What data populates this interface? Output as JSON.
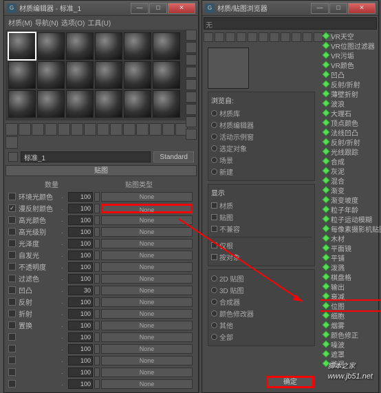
{
  "left": {
    "title": "材质编辑器 - 标准_1",
    "menu": [
      "材质(M)",
      "导航(N)",
      "选项(O)",
      "工具(U)"
    ],
    "material_name": "标准_1",
    "std_button": "Standard",
    "rollout": "贴图",
    "headers": {
      "amount": "数量",
      "type": "贴图类型"
    },
    "rows": [
      {
        "checked": false,
        "label": "环境光颜色",
        "val": "100",
        "btn": "None"
      },
      {
        "checked": true,
        "label": "漫反射颜色",
        "val": "100",
        "btn": "None",
        "highlight": true
      },
      {
        "checked": false,
        "label": "高光颜色",
        "val": "100",
        "btn": "None"
      },
      {
        "checked": false,
        "label": "高光级别",
        "val": "100",
        "btn": "None"
      },
      {
        "checked": false,
        "label": "光泽度",
        "val": "100",
        "btn": "None"
      },
      {
        "checked": false,
        "label": "自发光",
        "val": "100",
        "btn": "None"
      },
      {
        "checked": false,
        "label": "不透明度",
        "val": "100",
        "btn": "None"
      },
      {
        "checked": false,
        "label": "过滤色",
        "val": "100",
        "btn": "None"
      },
      {
        "checked": false,
        "label": "凹凸",
        "val": "30",
        "btn": "None"
      },
      {
        "checked": false,
        "label": "反射",
        "val": "100",
        "btn": "None"
      },
      {
        "checked": false,
        "label": "折射",
        "val": "100",
        "btn": "None"
      },
      {
        "checked": false,
        "label": "置换",
        "val": "100",
        "btn": "None"
      },
      {
        "checked": false,
        "label": "",
        "val": "100",
        "btn": "None"
      },
      {
        "checked": false,
        "label": "",
        "val": "100",
        "btn": "None"
      },
      {
        "checked": false,
        "label": "",
        "val": "100",
        "btn": "None"
      },
      {
        "checked": false,
        "label": "",
        "val": "100",
        "btn": "None"
      },
      {
        "checked": false,
        "label": "",
        "val": "100",
        "btn": "None"
      }
    ]
  },
  "right": {
    "title": "材质/贴图浏览器",
    "search_ph": "无",
    "browse": {
      "title": "浏览自:",
      "items": [
        "材质库",
        "材质编辑器",
        "活动示例窗",
        "选定对象",
        "场景",
        "新建"
      ]
    },
    "display": {
      "title": "显示",
      "items": [
        "材质",
        "贴图",
        "不兼容"
      ],
      "items2": [
        "仅根",
        "按对象"
      ]
    },
    "extra": [
      "2D 贴图",
      "3D 贴图",
      "合成器",
      "颜色修改器",
      "其他",
      "全部"
    ],
    "tree": [
      "VR天空",
      "VR位图过滤器",
      "VR污垢",
      "VR颜色",
      "凹凸",
      "反射/折射",
      "薄壁折射",
      "波浪",
      "大理石",
      "顶点颜色",
      "法线凹凸",
      "反射/折射",
      "光线跟踪",
      "合成",
      "灰泥",
      "混合",
      "渐变",
      "渐变坡度",
      "粒子年龄",
      "粒子运动模糊",
      "每像素摄影机贴图",
      "木材",
      "平面镜",
      "平铺",
      "泼溅",
      "棋盘格",
      "输出",
      "衰减",
      "位图",
      "细胞",
      "烟雾",
      "颜色修正",
      "噪波",
      "遮罩",
      "漩涡"
    ],
    "tree_hl_index": 28,
    "ok": "确定"
  },
  "watermark": {
    "main": "脚本之家",
    "sub": "www.jb51.net"
  }
}
